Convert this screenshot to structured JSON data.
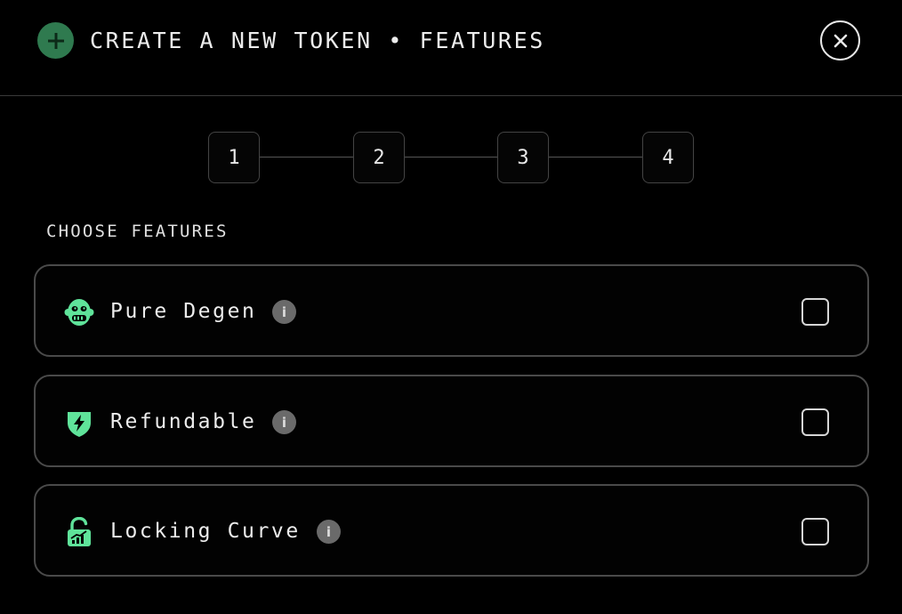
{
  "header": {
    "title": "CREATE A NEW TOKEN • FEATURES",
    "add_icon": "plus-icon",
    "close_icon": "close-icon"
  },
  "stepper": {
    "steps": [
      "1",
      "2",
      "3",
      "4"
    ]
  },
  "section_label": "CHOOSE FEATURES",
  "features": [
    {
      "label": "Pure Degen",
      "icon": "monkey-icon",
      "checked": false
    },
    {
      "label": "Refundable",
      "icon": "shield-bolt-icon",
      "checked": false
    },
    {
      "label": "Locking Curve",
      "icon": "unlocked-padlock-chart-icon",
      "checked": false
    }
  ],
  "colors": {
    "accent_green": "#5fe39a",
    "badge_green": "#2f7a4f",
    "background": "#000000",
    "border": "#4a4a4a"
  }
}
